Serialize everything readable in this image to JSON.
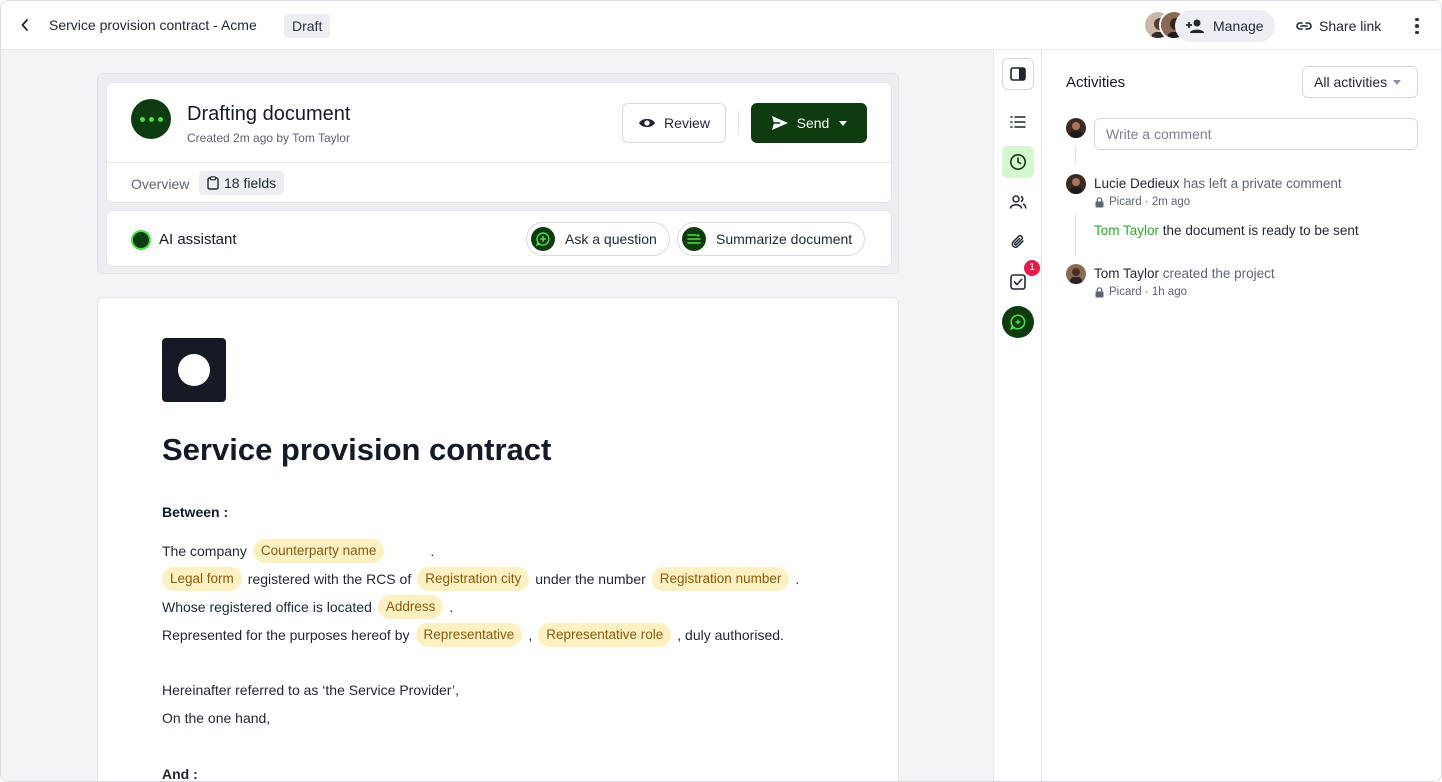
{
  "header": {
    "title": "Service provision contract - Acme",
    "status": "Draft",
    "manage_label": "Manage",
    "share_label": "Share link"
  },
  "doc_card": {
    "title": "Drafting document",
    "subtitle": "Created 2m ago by Tom Taylor",
    "review_label": "Review",
    "send_label": "Send",
    "tab_overview": "Overview",
    "fields_label": "18 fields"
  },
  "ai": {
    "title": "AI assistant",
    "ask_label": "Ask a question",
    "summarize_label": "Summarize document"
  },
  "document": {
    "heading": "Service provision contract",
    "between": "Between :",
    "line1_prefix": "The company",
    "line1_suffix": ".",
    "line2_mid1": "registered with the RCS of",
    "line2_mid2": "under the number",
    "line2_suffix": ".",
    "line3_prefix": "Whose registered office is located",
    "line3_suffix": ".",
    "line4_prefix": "Represented for the purposes hereof by",
    "line4_mid": ",",
    "line4_suffix": ", duly authorised.",
    "line5": "Hereinafter referred to as ‘the Service Provider’,",
    "line6": "On the one hand,",
    "and": "And :",
    "fields": {
      "counterparty_name": "Counterparty name",
      "legal_form": "Legal form",
      "registration_city": "Registration city",
      "registration_number": "Registration number",
      "address": "Address",
      "representative": "Representative",
      "representative_role": "Representative role"
    }
  },
  "rail": {
    "tasks_badge": "1"
  },
  "activities": {
    "title": "Activities",
    "filter_label": "All activities",
    "comment_placeholder": "Write a comment",
    "items": [
      {
        "actor": "Lucie Dedieux",
        "text": "has left a private comment",
        "meta": "Picard · 2m ago"
      },
      {
        "actor": "Tom Taylor",
        "text": "created the project",
        "meta": "Picard · 1h ago"
      }
    ],
    "nested_comment": {
      "actor": "Tom Taylor",
      "text": "the document is ready to be sent"
    }
  },
  "colors": {
    "brand_dark": "#0e3b10",
    "brand_accent": "#4ede47",
    "field_bg": "#fdf0c3",
    "field_text": "#8a5a0a",
    "badge_red": "#e5194d",
    "mention_green": "#2fa82a"
  },
  "icons": [
    "chevron-left-icon",
    "add-person-icon",
    "link-icon",
    "kebab-icon",
    "eye-icon",
    "send-icon",
    "clipboard-icon",
    "chat-sparkle-icon",
    "summary-icon",
    "panel-icon",
    "list-icon",
    "clock-icon",
    "users-icon",
    "paperclip-icon",
    "checkbox-icon",
    "lock-icon"
  ]
}
